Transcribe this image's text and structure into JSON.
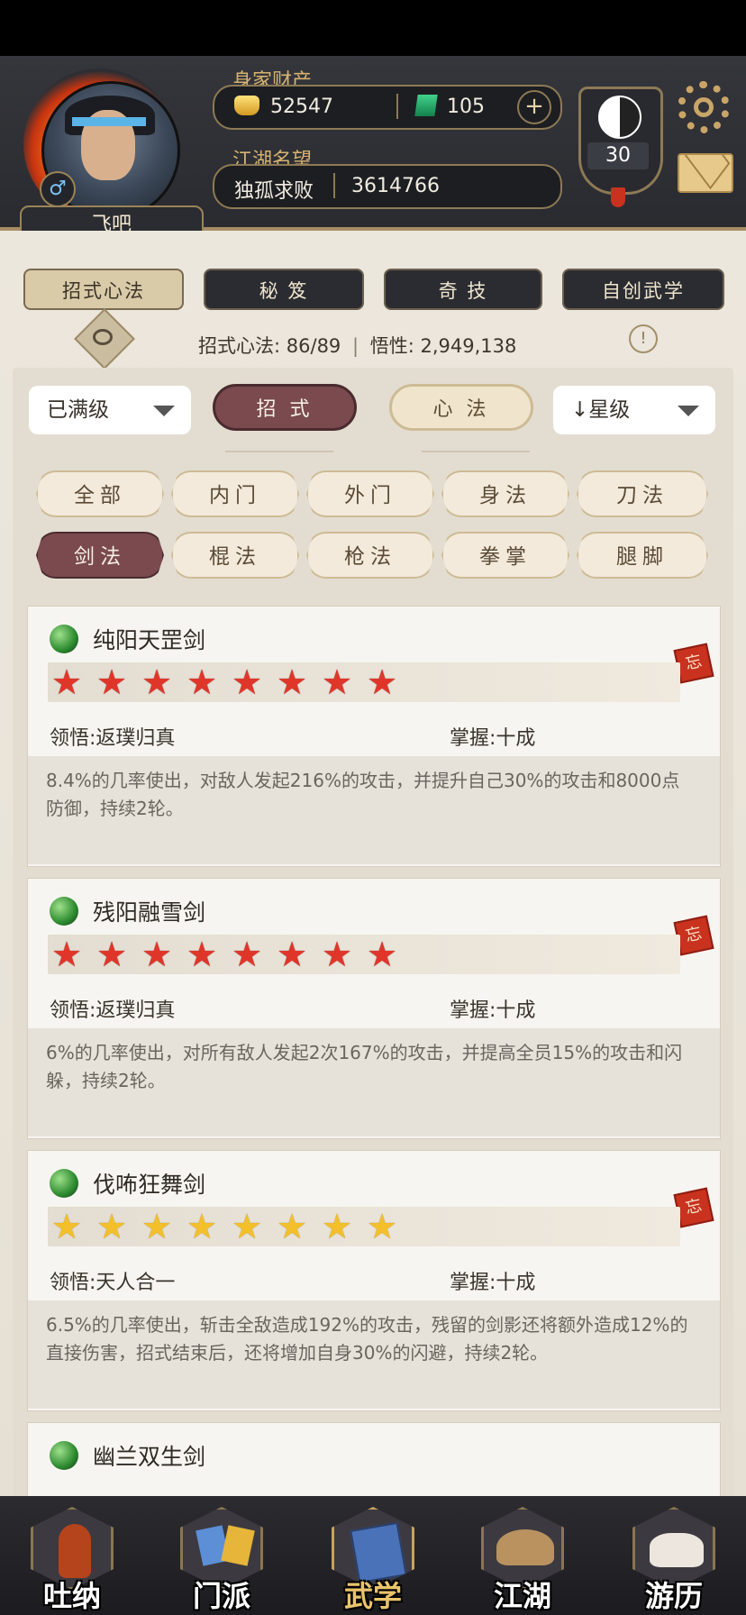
{
  "header": {
    "player_name": "飞吧",
    "gender_icon": "male-icon",
    "wealth_label": "身家财产",
    "gold_amount": "52547",
    "jade_amount": "105",
    "add_label": "+",
    "fame_label": "江湖名望",
    "fame_title": "独孤求败",
    "fame_value": "3614766",
    "level": "30"
  },
  "tabs": [
    {
      "label": "招式心法",
      "active": true
    },
    {
      "label": "秘 笈",
      "active": false
    },
    {
      "label": "奇 技",
      "active": false
    },
    {
      "label": "自创武学",
      "active": false
    }
  ],
  "stats": {
    "skills_label": "招式心法:",
    "skills_value": "86/89",
    "insight_label": "悟性:",
    "insight_value": "2,949,138",
    "info_symbol": "!"
  },
  "filters": {
    "level_filter": "已满级",
    "mode_moves": "招 式",
    "mode_inner": "心 法",
    "sort_label": "星级",
    "sort_arrow": "↓"
  },
  "categories": [
    {
      "label": "全部",
      "active": false
    },
    {
      "label": "内门",
      "active": false
    },
    {
      "label": "外门",
      "active": false
    },
    {
      "label": "身法",
      "active": false
    },
    {
      "label": "刀法",
      "active": false
    },
    {
      "label": "剑法",
      "active": true
    },
    {
      "label": "棍法",
      "active": false
    },
    {
      "label": "枪法",
      "active": false
    },
    {
      "label": "拳掌",
      "active": false
    },
    {
      "label": "腿脚",
      "active": false
    }
  ],
  "skills": [
    {
      "name": "纯阳天罡剑",
      "stars": 8,
      "star_color": "red",
      "comprehension_label": "领悟:",
      "comprehension": "返璞归真",
      "mastery_label": "掌握:",
      "mastery": "十成",
      "seal": "忘",
      "description": "8.4%的几率使出，对敌人发起216%的攻击，并提升自己30%的攻击和8000点防御，持续2轮。"
    },
    {
      "name": "残阳融雪剑",
      "stars": 8,
      "star_color": "red",
      "comprehension_label": "领悟:",
      "comprehension": "返璞归真",
      "mastery_label": "掌握:",
      "mastery": "十成",
      "seal": "忘",
      "description": "6%的几率使出，对所有敌人发起2次167%的攻击，并提高全员15%的攻击和闪躲，持续2轮。"
    },
    {
      "name": "伐咘狂舞剑",
      "stars": 8,
      "star_color": "yellow",
      "comprehension_label": "领悟:",
      "comprehension": "天人合一",
      "mastery_label": "掌握:",
      "mastery": "十成",
      "seal": "忘",
      "description": "6.5%的几率使出，斩击全敌造成192%的攻击，残留的剑影还将额外造成12%的直接伤害，招式结束后，还将增加自身30%的闪避，持续2轮。"
    },
    {
      "name": "幽兰双生剑"
    }
  ],
  "bottom_nav": [
    {
      "label": "吐纳",
      "icon": "meditation-icon",
      "active": false
    },
    {
      "label": "门派",
      "icon": "sect-icon",
      "active": false
    },
    {
      "label": "武学",
      "icon": "book-icon",
      "active": true
    },
    {
      "label": "江湖",
      "icon": "straw-hat-icon",
      "active": false
    },
    {
      "label": "游历",
      "icon": "horse-icon",
      "active": false
    }
  ]
}
